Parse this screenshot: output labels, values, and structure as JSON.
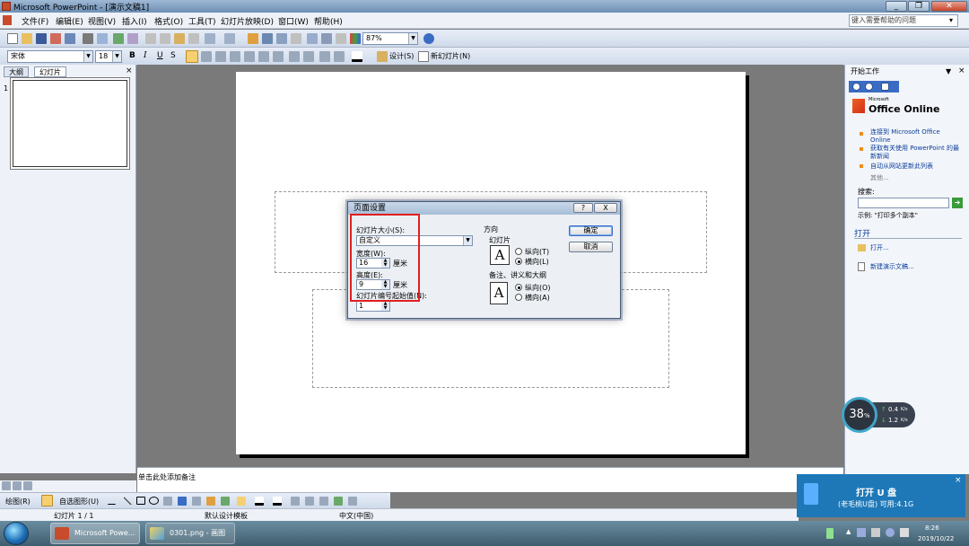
{
  "window": {
    "title": "Microsoft PowerPoint - [演示文稿1]"
  },
  "menu": {
    "items": [
      "文件(F)",
      "编辑(E)",
      "视图(V)",
      "插入(I)",
      "格式(O)",
      "工具(T)",
      "幻灯片放映(D)",
      "窗口(W)",
      "帮助(H)"
    ],
    "help_placeholder": "键入需要帮助的问题"
  },
  "toolbar": {
    "zoom": "87%"
  },
  "format_toolbar": {
    "font": "宋体",
    "size": "18",
    "bold": "B",
    "italic": "I",
    "underline": "U",
    "shadow": "S",
    "design": "设计(S)",
    "new_slide": "新幻灯片(N)"
  },
  "left_pane": {
    "tabs": [
      "大纲",
      "幻灯片"
    ],
    "slide_number": "1"
  },
  "dialog": {
    "title": "页面设置",
    "size_label": "幻灯片大小(S):",
    "size_value": "自定义",
    "width_label": "宽度(W):",
    "width_value": "16",
    "unit": "厘米",
    "height_label": "高度(E):",
    "height_value": "9",
    "start_label": "幻灯片编号起始值(N):",
    "start_value": "1",
    "orientation_label": "方向",
    "slides_group": "幻灯片",
    "notes_group": "备注、讲义和大纲",
    "portrait_slides": "纵向(T)",
    "landscape_slides": "横向(L)",
    "portrait_notes": "纵向(O)",
    "landscape_notes": "横向(A)",
    "ok": "确定",
    "cancel": "取消",
    "help_btn": "?",
    "close_btn": "X"
  },
  "notes": {
    "placeholder": "单击此处添加备注"
  },
  "draw_toolbar": {
    "draw": "绘图(R)",
    "autoshape": "自选图形(U)"
  },
  "status": {
    "slide": "幻灯片 1 / 1",
    "template": "默认设计模板",
    "language": "中文(中国)"
  },
  "task_pane": {
    "title": "开始工作",
    "logo_sub": "Microsoft",
    "logo": "Office Online",
    "links": [
      "连接到 Microsoft Office Online",
      "获取有关使用 PowerPoint 的最新新闻",
      "自动从网站更新此列表"
    ],
    "more": "其他...",
    "search_label": "搜索:",
    "example": "示例: \"打印多个副本\"",
    "open_section": "打开",
    "open_link": "打开...",
    "new_link": "新建演示文稿..."
  },
  "net_meter": {
    "percent": "38",
    "percent_unit": "%",
    "up": "0.4",
    "down": "1.2",
    "rate_unit": "K/s"
  },
  "usb_toast": {
    "title": "打开 U 盘",
    "subtitle": "(老毛桃U盘)  可用:4.1G"
  },
  "taskbar": {
    "tasks": [
      "Microsoft Powe...",
      "0301.png - 画图"
    ],
    "time": "8:26",
    "date": "2019/10/22"
  }
}
